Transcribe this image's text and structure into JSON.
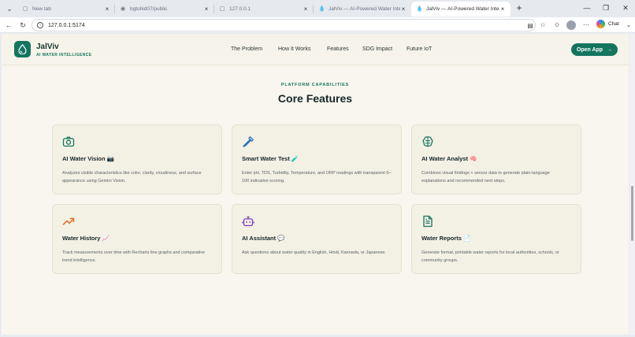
{
  "browser": {
    "tabs": [
      {
        "label": "New tab",
        "icon": "page-icon"
      },
      {
        "label": "bgtohid07/public",
        "icon": "github-icon"
      },
      {
        "label": "127.0.0.1",
        "icon": "page-icon"
      },
      {
        "label": "JalViv — AI-Powered Water Intellig",
        "icon": "drop-icon"
      },
      {
        "label": "JalViv — AI-Powered Water Intellig",
        "icon": "drop-icon",
        "active": true
      }
    ],
    "url": "127.0.0.1:5174",
    "chat_label": "Chat"
  },
  "site": {
    "logo_name": "JalViv",
    "logo_tagline": "AI WATER INTELLIGENCE",
    "nav": [
      "The Problem",
      "How It Works",
      "Features",
      "SDG Impact",
      "Future IoT"
    ],
    "cta_label": "Open App",
    "brand_color": "#14755f"
  },
  "section": {
    "eyebrow": "PLATFORM CAPABILITIES",
    "title": "Core Features"
  },
  "features": [
    {
      "title": "AI Water Vision 📷",
      "icon": "camera-icon",
      "icon_color": "#14755f",
      "desc": "Analyzes visible characteristics like color, clarity, cloudiness, and surface appearance using Gemini Vision."
    },
    {
      "title": "Smart Water Test 🧪",
      "icon": "pipette-icon",
      "icon_color": "#1f6fb8",
      "desc": "Enter pH, TDS, Turbidity, Temperature, and ORP readings with transparent 0–100 indicative scoring."
    },
    {
      "title": "AI Water Analyst 🧠",
      "icon": "brain-icon",
      "icon_color": "#14755f",
      "desc": "Combines visual findings + sensor data to generate plain-language explanations and recommended next steps."
    },
    {
      "title": "Water History 📈",
      "icon": "trending-up-icon",
      "icon_color": "#e0752a",
      "desc": "Track measurements over time with Recharts line graphs and comparative trend intelligence."
    },
    {
      "title": "AI Assistant 💬",
      "icon": "bot-icon",
      "icon_color": "#7a3fb8",
      "desc": "Ask questions about water quality in English, Hindi, Kannada, or Japanese."
    },
    {
      "title": "Water Reports 📄",
      "icon": "file-text-icon",
      "icon_color": "#14755f",
      "desc": "Generate formal, printable water reports for local authorities, schools, or community groups."
    }
  ]
}
